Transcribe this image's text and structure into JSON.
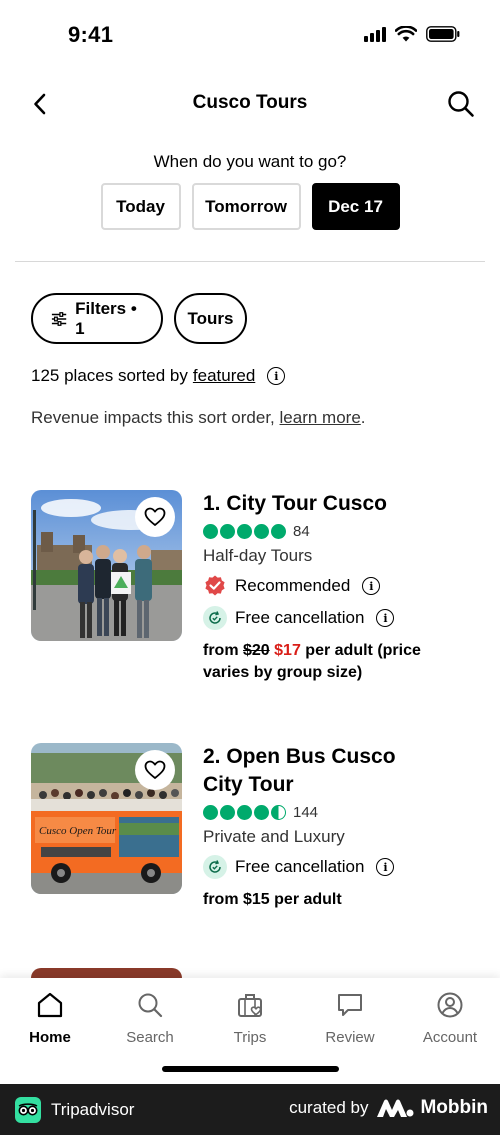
{
  "status": {
    "time": "9:41"
  },
  "header": {
    "title": "Cusco Tours"
  },
  "date_picker": {
    "question": "When do you want to go?",
    "options": [
      {
        "label": "Today",
        "selected": false
      },
      {
        "label": "Tomorrow",
        "selected": false
      },
      {
        "label": "Dec 17",
        "selected": true
      }
    ]
  },
  "chips": {
    "filters_label": "Filters • 1",
    "tours_label": "Tours"
  },
  "sort": {
    "prefix": "125 places sorted by",
    "link": "featured",
    "revenue_text": "Revenue impacts this sort order, ",
    "revenue_link": "learn more",
    "revenue_suffix": "."
  },
  "listings": [
    {
      "title": "1. City Tour Cusco",
      "rating": 5,
      "reviews": "84",
      "category": "Half-day Tours",
      "recommended": "Recommended",
      "cancellation": "Free cancellation",
      "price_prefix": "from ",
      "price_old": "$20",
      "price_new": "$17",
      "price_suffix": " per adult (price varies by group size)"
    },
    {
      "title": "2. Open Bus Cusco City Tour",
      "rating": 4.5,
      "reviews": "144",
      "category": "Private and Luxury",
      "cancellation": "Free cancellation",
      "price_text": "from $15 per adult",
      "bus_sign": "Cusco Open Tour"
    }
  ],
  "tabs": [
    {
      "label": "Home",
      "icon": "home-icon",
      "active": true
    },
    {
      "label": "Search",
      "icon": "search-icon",
      "active": false
    },
    {
      "label": "Trips",
      "icon": "suitcase-heart-icon",
      "active": false
    },
    {
      "label": "Review",
      "icon": "review-bubble-icon",
      "active": false
    },
    {
      "label": "Account",
      "icon": "account-icon",
      "active": false
    }
  ],
  "footer": {
    "brand": "Tripadvisor",
    "curated_by": "curated by",
    "curator": "Mobbin"
  },
  "colors": {
    "rating_green": "#00aa6c",
    "sale_red": "#d91e18",
    "recommended_red": "#e04848",
    "mint": "#d6f2e7",
    "footer_bg": "#1c1c1c"
  }
}
